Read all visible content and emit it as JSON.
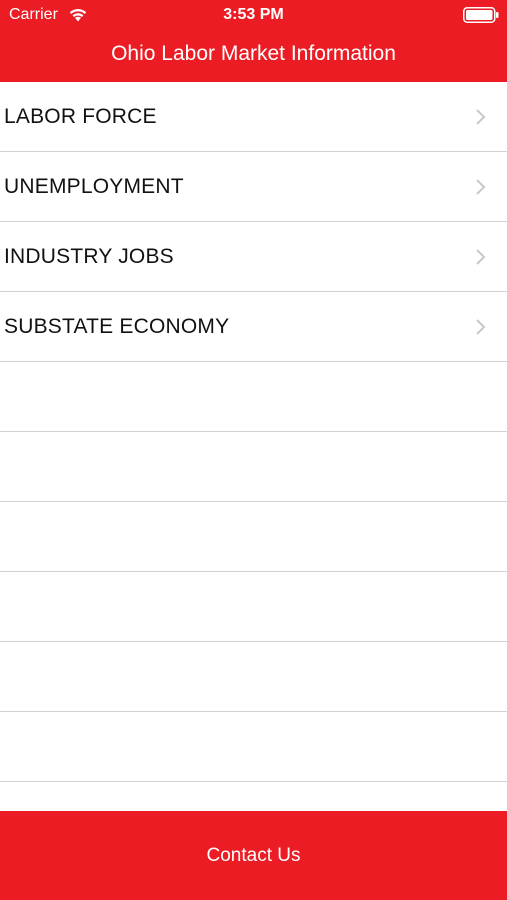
{
  "status_bar": {
    "carrier": "Carrier",
    "time": "3:53 PM",
    "wifi_icon": "wifi-icon",
    "battery_icon": "battery-full-icon"
  },
  "nav": {
    "title": "Ohio Labor Market Information"
  },
  "menu": {
    "items": [
      {
        "label": "LABOR FORCE"
      },
      {
        "label": "UNEMPLOYMENT"
      },
      {
        "label": "INDUSTRY JOBS"
      },
      {
        "label": "SUBSTATE ECONOMY"
      }
    ],
    "chevron_icon": "chevron-right-icon"
  },
  "footer": {
    "contact_label": "Contact Us"
  },
  "colors": {
    "brand_red": "#ec1c24",
    "separator": "#d2d2d6",
    "chevron": "#c7c7cc"
  }
}
